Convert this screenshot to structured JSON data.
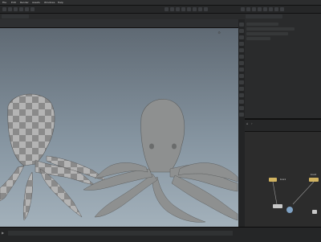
{
  "menu": {
    "items": [
      "File",
      "Edit",
      "Render",
      "Assets",
      "Windows",
      "Help"
    ]
  },
  "viewport": {
    "bg_top": "#5c6670",
    "bg_bottom": "#a3b1bb",
    "mesh_color": "#8e9090",
    "checker_light": "#b4b4b4",
    "checker_dark": "#8a8a8a"
  },
  "network": {
    "nodes": [
      {
        "label": "box1"
      },
      {
        "label": "box2"
      },
      {
        "label": ""
      },
      {
        "label": ""
      }
    ]
  },
  "colors": {
    "accent": "#d1b360",
    "panel": "#2a2b2c"
  }
}
